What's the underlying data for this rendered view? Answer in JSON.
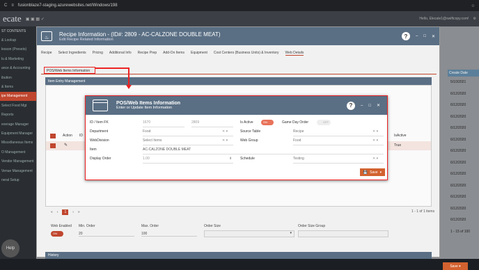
{
  "browser": {
    "url": "fusionblaze7-staging.azurewebsites.net/Windows/198"
  },
  "app": {
    "logo": "ecate",
    "user": "Hello, Elecate1@swiftcopy.com!"
  },
  "sidebar": {
    "items": [
      "ST CONTENTS",
      "& Lookup",
      "lesson (Presets)",
      "lu & Marketing",
      "ance & Accounting",
      "ibution",
      "& Items",
      "ipe Management",
      "Select Food Mgt",
      "Reports",
      "everage Manager",
      "Equipment Manager",
      "Miscellaneous Items",
      "O Management",
      "Vendor Management",
      "Venue Management",
      "neral Setup"
    ],
    "active_index": 7,
    "help": "Help"
  },
  "right_col": {
    "header": "Create Date",
    "dates": [
      "5/10/2021",
      "6/12/2020",
      "6/12/2020",
      "6/12/2020",
      "6/12/2020",
      "6/12/2020",
      "6/12/2020",
      "6/12/2020",
      "6/12/2020",
      "6/12/2020",
      "6/12/2020",
      "6/12/2020",
      "6/12/2020"
    ],
    "footer": "1 - 15 of 100"
  },
  "modal1": {
    "title": "Recipe Information - (ID#: 2809 - AC-CALZONE DOUBLE MEAT)",
    "subtitle": "Edit Recipe Related Information",
    "tabs": [
      "Recipe",
      "Select Ingredients",
      "Pricing",
      "Additional Info",
      "Recipe Prep",
      "Add-On Items",
      "Equipment",
      "Cost Centers (Business Units) & Inventory",
      "Web Details"
    ],
    "active_tab": "Web Details",
    "pos_button": "POS/Web Items Information",
    "section": "Item Entry Management",
    "grid_headers": {
      "action": "Action",
      "id": "ID",
      "isactive": "IsActive"
    },
    "grid_row_isactive": "True",
    "pager": {
      "page": "1",
      "items": "1 - 1 of 1 items"
    },
    "web": {
      "enabled_label": "Web Enabled",
      "enabled_value": "ON",
      "min_label": "Min. Order",
      "min_value": "20",
      "max_label": "Max. Order",
      "max_value": "100",
      "size_label": "Order Size",
      "group_label": "Order Size Group"
    },
    "history": "History",
    "save": "Save"
  },
  "modal2": {
    "title": "POS/Web Items Information",
    "subtitle": "Enter or Update Item Information",
    "fields": {
      "id_label": "ID / Item FK",
      "id_value": "1670",
      "fk_value": "2809",
      "isactive_label": "Is Active",
      "isactive_value": "ON",
      "gameday_label": "Game Day Order",
      "gameday_value": "OFF",
      "dept_label": "Department",
      "dept_value": "Food",
      "source_label": "Source Table",
      "source_value": "Recipe",
      "webdiv_label": "WebDivision",
      "webdiv_value": "Select Items",
      "webgroup_label": "Web Group",
      "webgroup_value": "Food",
      "item_label": "Item",
      "item_value": "AC-CALZONE DOUBLE MEAT",
      "order_label": "Display Order",
      "order_value": "1.00",
      "schedule_label": "Schedule",
      "schedule_value": "Testing"
    },
    "save": "Save"
  },
  "colors": {
    "accent": "#c0462e",
    "header": "#5a6f84",
    "highlight": "#e22222"
  }
}
